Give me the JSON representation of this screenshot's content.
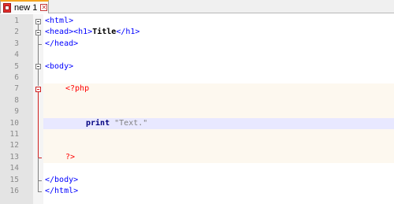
{
  "tab": {
    "label": "new 1",
    "close_glyph": "✕"
  },
  "lines": [
    {
      "num": "1"
    },
    {
      "num": "2"
    },
    {
      "num": "3"
    },
    {
      "num": "4"
    },
    {
      "num": "5"
    },
    {
      "num": "6"
    },
    {
      "num": "7"
    },
    {
      "num": "8"
    },
    {
      "num": "9"
    },
    {
      "num": "10"
    },
    {
      "num": "11"
    },
    {
      "num": "12"
    },
    {
      "num": "13"
    },
    {
      "num": "14"
    },
    {
      "num": "15"
    },
    {
      "num": "16"
    }
  ],
  "code": {
    "l1": "<html>",
    "l2a": "<head><h1>",
    "l2b": "Title",
    "l2c": "</h1>",
    "l3": "</head>",
    "l5": "<body>",
    "l7": "<?php",
    "l10a": "print",
    "l10b": " \"Text.\"",
    "l13": "?>",
    "l15": "</body>",
    "l16": "</html>"
  },
  "colors": {
    "tag": "#0000ff",
    "php_delimiter": "#ff0000",
    "keyword": "#000080",
    "string": "#808080",
    "php_background": "#fdf8ef",
    "current_line": "#e8e8ff"
  }
}
